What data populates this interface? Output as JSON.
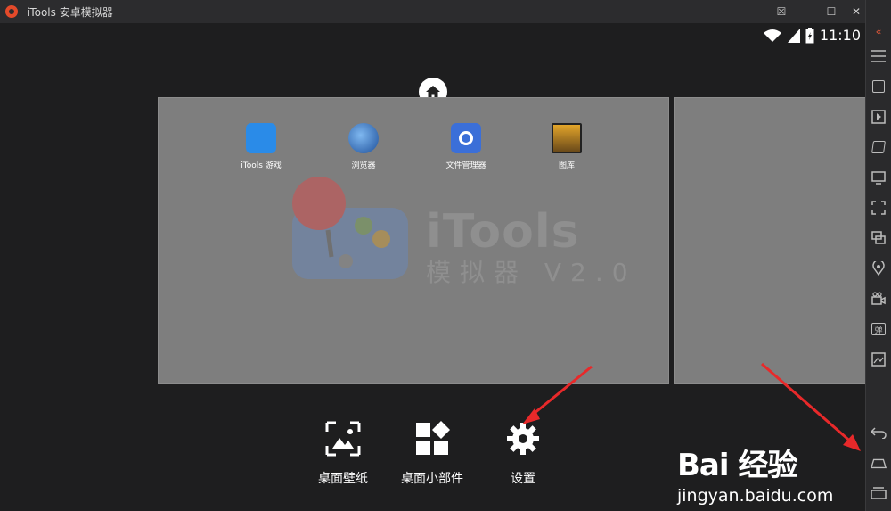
{
  "window": {
    "title": "iTools 安卓模拟器"
  },
  "window_controls": {
    "feedback": "☒",
    "minimize": "—",
    "maximize": "☐",
    "close": "✕"
  },
  "status_bar": {
    "time": "11:10"
  },
  "apps": [
    {
      "label": "iTools 游戏",
      "color": "#2a8be8"
    },
    {
      "label": "浏览器",
      "color": "#3d7fc4"
    },
    {
      "label": "文件管理器",
      "color": "#3b6fd8"
    },
    {
      "label": "图库",
      "color": "#c78a1c"
    }
  ],
  "watermark": {
    "title": "iTools",
    "subtitle": "模拟器 V2.0"
  },
  "bottom_actions": [
    {
      "label": "桌面壁纸",
      "icon": "wallpaper-icon"
    },
    {
      "label": "桌面小部件",
      "icon": "widgets-icon"
    },
    {
      "label": "设置",
      "icon": "gear-icon"
    }
  ],
  "sidebar": {
    "items": [
      "collapse-icon",
      "menu-icon",
      "keyboard-icon",
      "video-icon",
      "shake-icon",
      "display-icon",
      "fullscreen-icon",
      "multi-window-icon",
      "location-icon",
      "camera-icon",
      "danmaku-icon",
      "screenshot-icon",
      "back-icon",
      "home-icon",
      "recents-icon"
    ],
    "danmaku_label": "弹"
  },
  "watermark_overlay": {
    "brand": "Bai 经验",
    "url": "jingyan.baidu.com"
  },
  "colors": {
    "accent_red": "#e8292a",
    "panel": "#7e7e7e",
    "background": "#1e1e1f"
  }
}
